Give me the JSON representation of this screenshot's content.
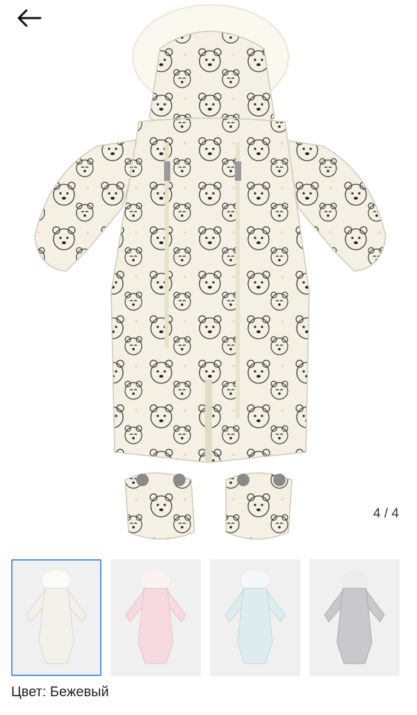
{
  "nav": {
    "back_icon": "arrow-left-icon"
  },
  "gallery": {
    "counter": "4 / 4",
    "thumbnails": [
      {
        "name": "thumb-beige",
        "color": "#f3f1ea",
        "selected": true
      },
      {
        "name": "thumb-pink",
        "color": "#f6d9e1",
        "selected": false
      },
      {
        "name": "thumb-blue",
        "color": "#dcecef",
        "selected": false
      },
      {
        "name": "thumb-silver",
        "color": "#c9c9cc",
        "selected": false
      }
    ]
  },
  "product": {
    "color_label": "Цвет: Бежевый"
  },
  "colors": {
    "accent": "#5a8fe0",
    "garment": "#f4f1e4",
    "fur": "#fbf8f0"
  }
}
